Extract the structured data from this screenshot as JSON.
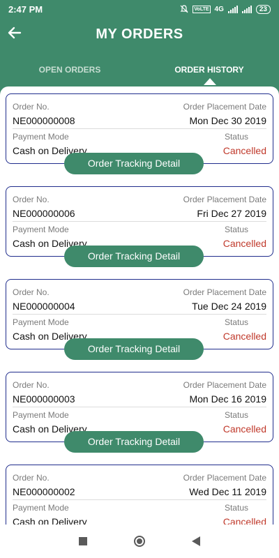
{
  "status_bar": {
    "time": "2:47 PM",
    "network": "4G",
    "volte": "VoLTE",
    "battery": "23"
  },
  "header": {
    "title": "MY ORDERS"
  },
  "tabs": [
    {
      "label": "OPEN ORDERS",
      "active": false
    },
    {
      "label": "ORDER HISTORY",
      "active": true
    }
  ],
  "labels": {
    "order_no": "Order No.",
    "placement_date": "Order Placement Date",
    "payment_mode": "Payment Mode",
    "status": "Status",
    "track_button": "Order Tracking Detail"
  },
  "orders": [
    {
      "order_no": "NE000000008",
      "date": "Mon Dec 30 2019",
      "payment": "Cash on Delivery",
      "status": "Cancelled"
    },
    {
      "order_no": "NE000000006",
      "date": "Fri Dec 27 2019",
      "payment": "Cash on Delivery",
      "status": "Cancelled"
    },
    {
      "order_no": "NE000000004",
      "date": "Tue Dec 24 2019",
      "payment": "Cash on Delivery",
      "status": "Cancelled"
    },
    {
      "order_no": "NE000000003",
      "date": "Mon Dec 16 2019",
      "payment": "Cash on Delivery",
      "status": "Cancelled"
    },
    {
      "order_no": "NE000000002",
      "date": "Wed Dec 11 2019",
      "payment": "Cash on Delivery",
      "status": "Cancelled"
    }
  ],
  "colors": {
    "brand": "#3f8a6b",
    "card_border": "#1f2c8c",
    "status_cancelled": "#c0392b"
  },
  "icons": {
    "back": "back-arrow-icon",
    "recents": "recents-square-icon",
    "home": "home-circle-icon",
    "nav_back": "nav-back-triangle-icon"
  }
}
